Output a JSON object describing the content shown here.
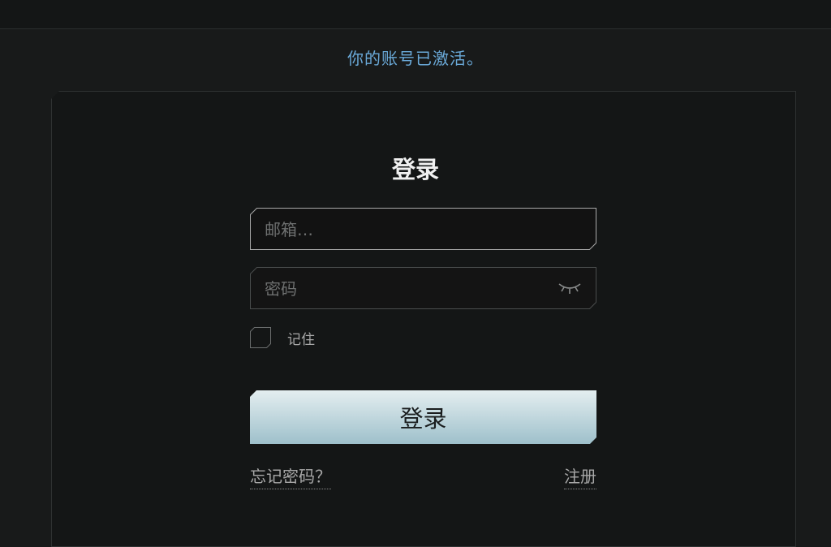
{
  "notice": {
    "text": "你的账号已激活。",
    "color": "#6aa9d8"
  },
  "login": {
    "title": "登录",
    "email": {
      "placeholder": "邮箱…",
      "value": ""
    },
    "password": {
      "placeholder": "密码",
      "value": "",
      "toggle_icon": "eye-closed-icon"
    },
    "remember": {
      "label": "记住",
      "checked": false
    },
    "submit_label": "登录",
    "forgot_label": "忘记密码？",
    "register_label": "注册"
  },
  "colors": {
    "background": "#181a1a",
    "card": "#141616",
    "button_top": "#e4eef0",
    "button_bottom": "#9ec0cb",
    "muted_text": "#a8a8a8"
  }
}
